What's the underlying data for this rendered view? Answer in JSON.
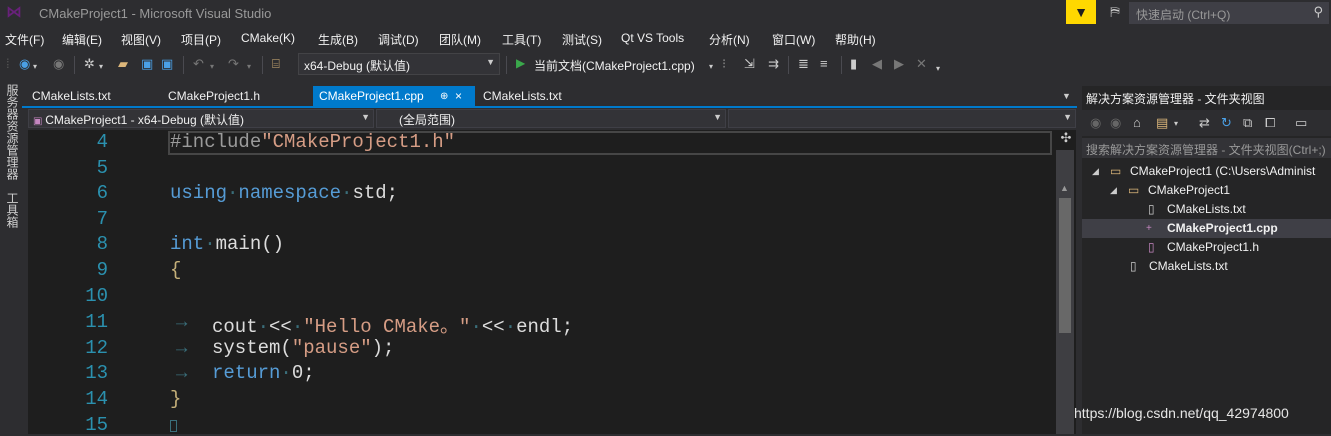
{
  "window": {
    "title": "CMakeProject1 - Microsoft Visual Studio"
  },
  "quick_launch": {
    "placeholder": "快速启动 (Ctrl+Q)"
  },
  "menu": [
    "文件(F)",
    "编辑(E)",
    "视图(V)",
    "项目(P)",
    "CMake(K)",
    "生成(B)",
    "调试(D)",
    "团队(M)",
    "工具(T)",
    "测试(S)",
    "Qt VS Tools",
    "分析(N)",
    "窗口(W)",
    "帮助(H)"
  ],
  "toolbar": {
    "configuration": "x64-Debug (默认值)",
    "run_target": "当前文档(CMakeProject1.cpp)"
  },
  "left_strip": {
    "server_explorer": "服务器资源管理器",
    "toolbox": "工具箱"
  },
  "tabs": [
    {
      "label": "CMakeLists.txt"
    },
    {
      "label": "CMakeProject1.h"
    },
    {
      "label": "CMakeProject1.cpp",
      "pin": "⊕",
      "close": "×"
    },
    {
      "label": "CMakeLists.txt"
    }
  ],
  "navbar": {
    "project": "CMakeProject1 - x64-Debug (默认值)",
    "scope": "(全局范围)"
  },
  "editor": {
    "line_numbers": [
      "4",
      "5",
      "6",
      "7",
      "8",
      "9",
      "10",
      "11",
      "12",
      "13",
      "14",
      "15"
    ],
    "line4": {
      "directive": "#include",
      "file": "\"CMakeProject1.h\""
    },
    "line6": {
      "kw_using": "using",
      "kw_namespace": "namespace",
      "ns": "std;"
    },
    "line8": {
      "type": "int",
      "name": "main()"
    },
    "line9": {
      "brace": "{"
    },
    "line11": {
      "a": "cout",
      "op1": "<<",
      "str": "\"Hello CMake。\"",
      "op2": "<<",
      "b": "endl;"
    },
    "line12": {
      "fn": "system(",
      "str": "\"pause\"",
      "end": ");"
    },
    "line13": {
      "kw": "return",
      "val": "0;"
    },
    "line14": {
      "brace": "}"
    },
    "tab_glyph": "→"
  },
  "solution_explorer": {
    "title": "解决方案资源管理器 - 文件夹视图",
    "search_placeholder": "搜索解决方案资源管理器 - 文件夹视图(Ctrl+;)",
    "tree": [
      {
        "label": "CMakeProject1 (C:\\Users\\Administ",
        "level": 0,
        "icon": "folder-icon",
        "expanded": true
      },
      {
        "label": "CMakeProject1",
        "level": 1,
        "icon": "folder-icon",
        "expanded": true
      },
      {
        "label": "CMakeLists.txt",
        "level": 2,
        "icon": "file-icon"
      },
      {
        "label": "CMakeProject1.cpp",
        "level": 2,
        "icon": "cpp-file-icon",
        "selected": true
      },
      {
        "label": "CMakeProject1.h",
        "level": 2,
        "icon": "header-file-icon"
      },
      {
        "label": "CMakeLists.txt",
        "level": 1,
        "icon": "file-icon"
      }
    ]
  },
  "watermark": "https://blog.csdn.net/qq_42974800",
  "colors": {
    "accent": "#007acc",
    "keyword": "#569cd6",
    "string": "#d69d85",
    "line_number": "#2b91af",
    "notification": "#ffd800"
  }
}
